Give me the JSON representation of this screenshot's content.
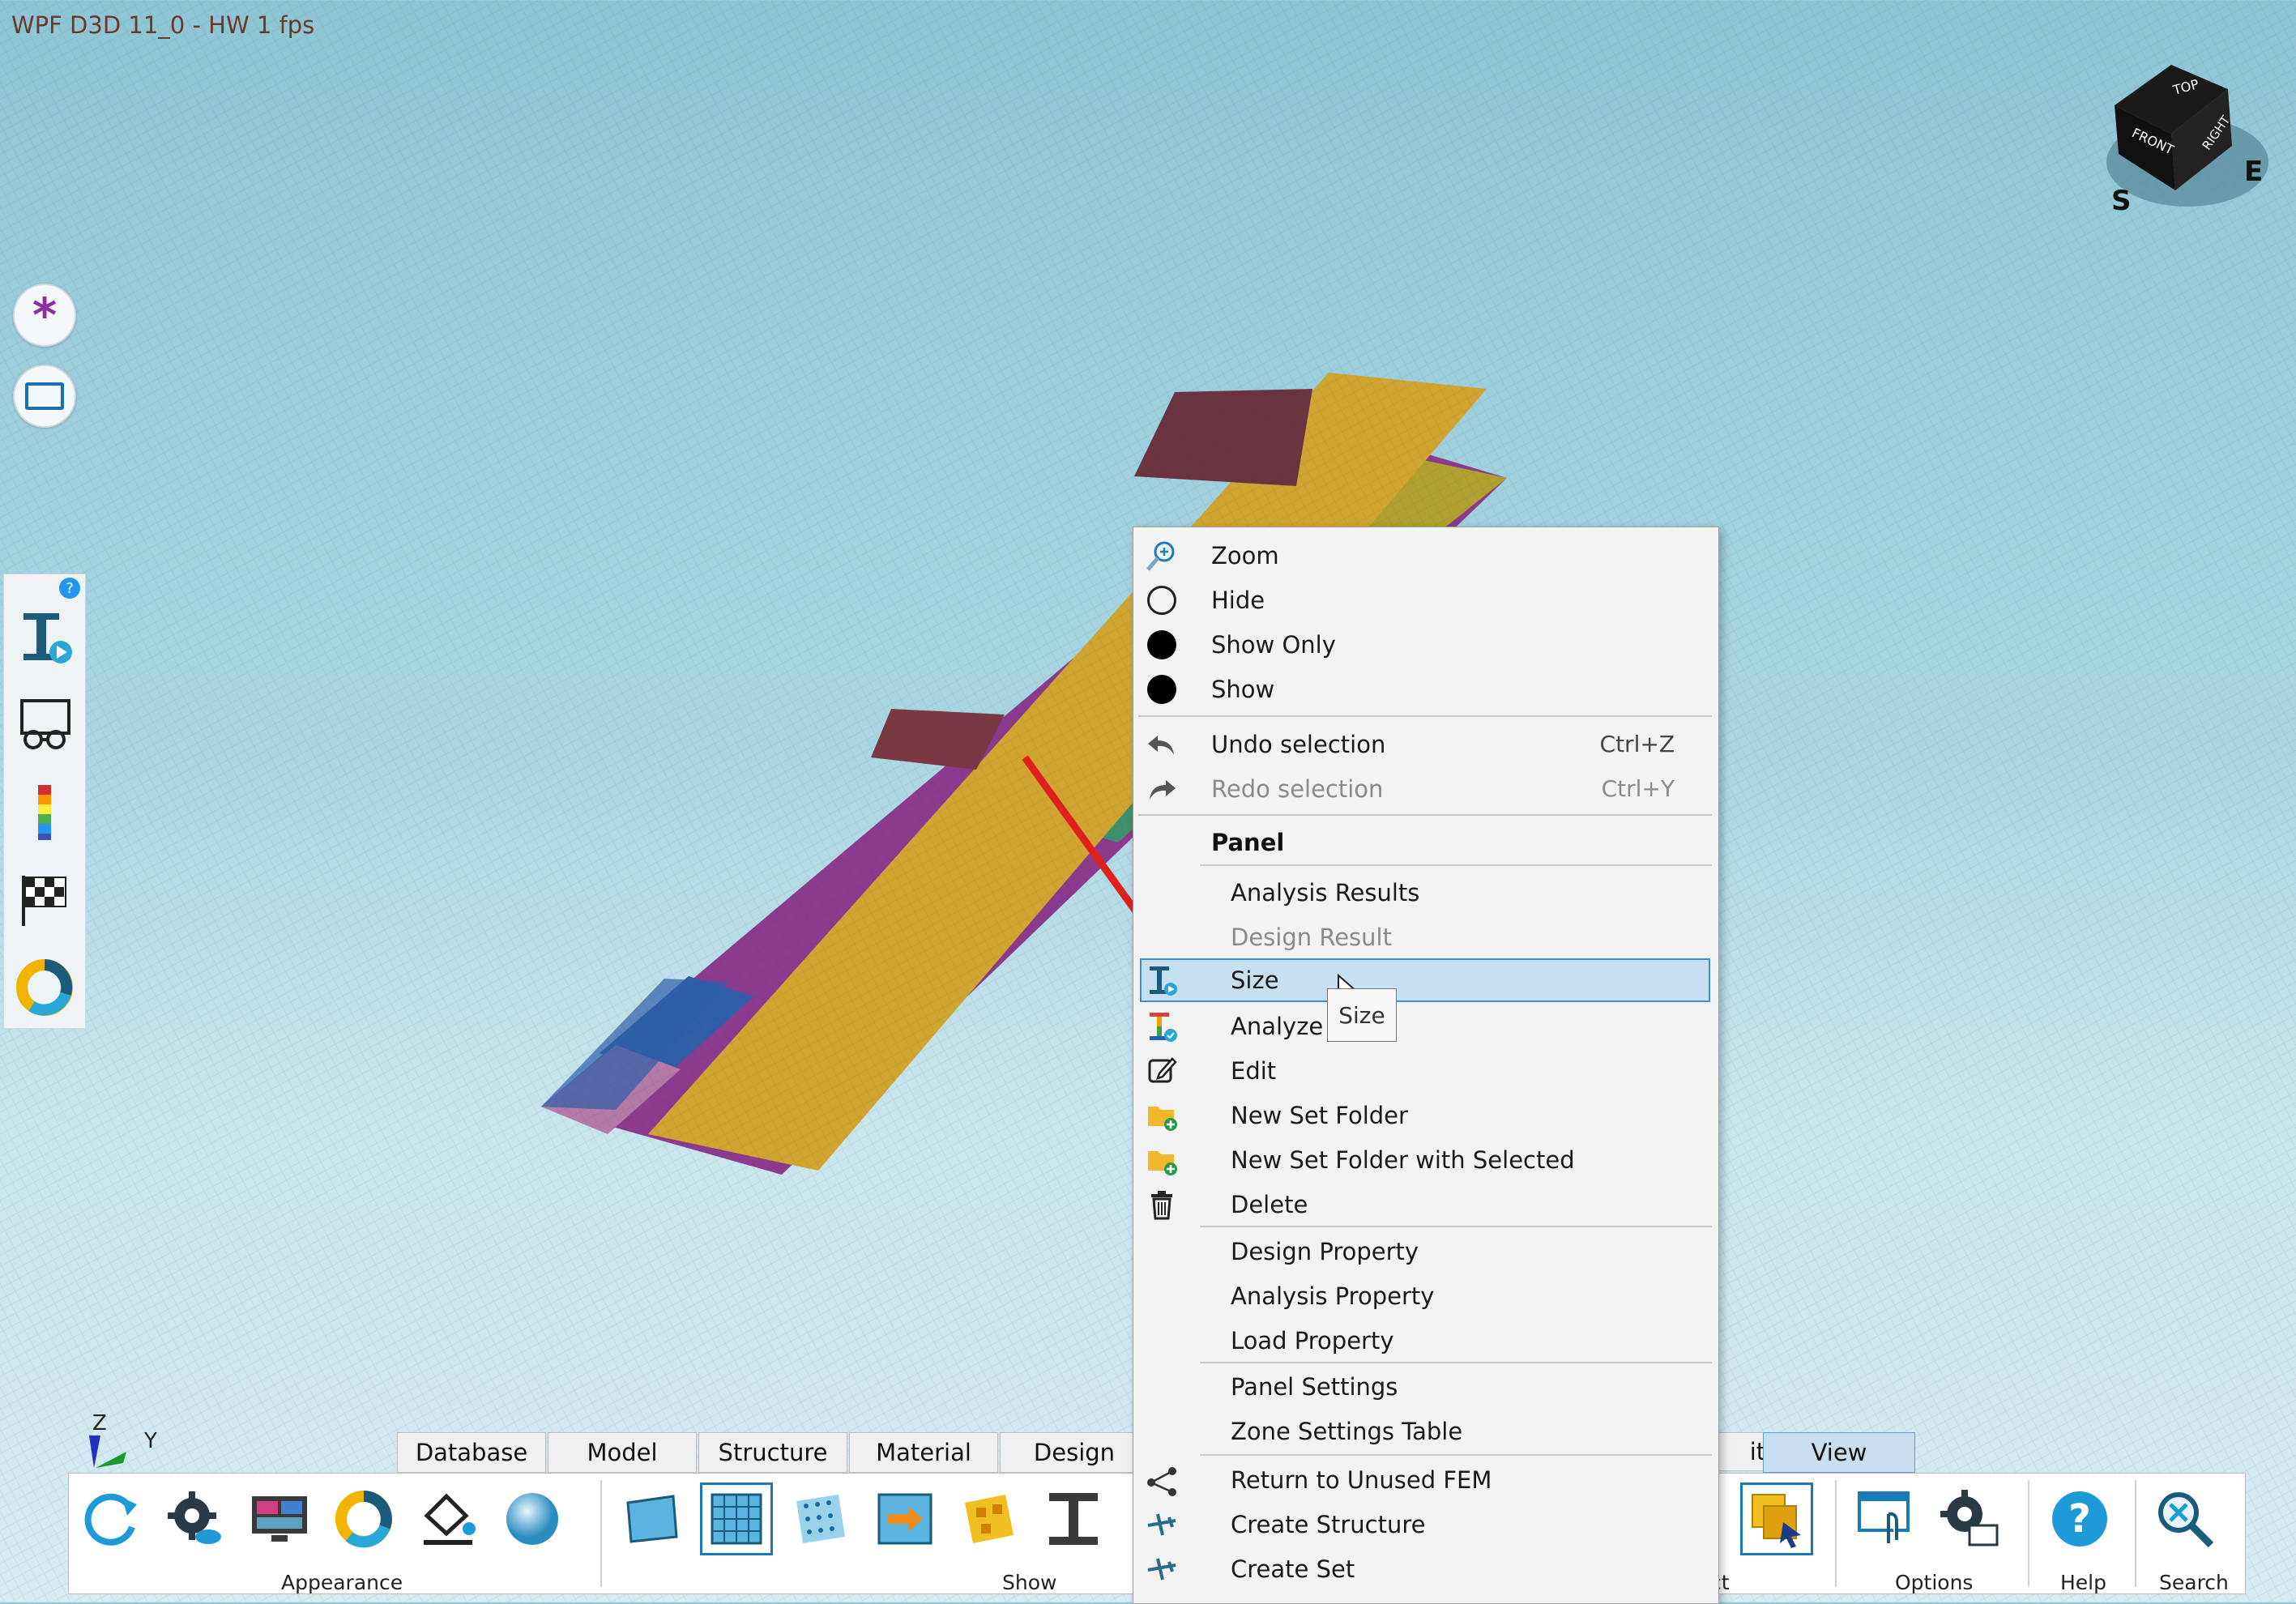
{
  "window": {
    "title": "WPF D3D 11_0 - HW 1 fps"
  },
  "viewcube": {
    "top": "TOP",
    "front": "FRONT",
    "right": "RIGHT",
    "compass_s": "S",
    "compass_e": "E"
  },
  "axes": {
    "z": "Z",
    "y": "Y"
  },
  "left_buttons": [
    {
      "name": "asterisk-icon"
    },
    {
      "name": "rectangle-select-icon"
    }
  ],
  "left_tools": {
    "help": "?"
  },
  "context_menu": {
    "items_top": [
      {
        "label": "Zoom",
        "icon": "zoom-icon"
      },
      {
        "label": "Hide",
        "icon": "circle-outline-icon"
      },
      {
        "label": "Show Only",
        "icon": "circle-filled-icon"
      },
      {
        "label": "Show",
        "icon": "circle-filled-icon"
      }
    ],
    "undo": {
      "label": "Undo selection",
      "shortcut": "Ctrl+Z"
    },
    "redo": {
      "label": "Redo selection",
      "shortcut": "Ctrl+Y"
    },
    "header": "Panel",
    "panel_items": [
      "Analysis Results",
      "Design Result",
      "Size",
      "Analyze",
      "Edit",
      "New Set Folder",
      "New Set Folder with Selected",
      "Delete"
    ],
    "property_items": [
      "Design Property",
      "Analysis Property",
      "Load Property"
    ],
    "settings_items": [
      "Panel Settings",
      "Zone Settings Table"
    ],
    "bottom_items": [
      "Return to Unused FEM",
      "Create Structure",
      "Create Set"
    ]
  },
  "tooltip": "Size",
  "ribbon": {
    "tabs": [
      "Database",
      "Model",
      "Structure",
      "Material",
      "Design",
      "ite",
      "View"
    ],
    "groups": {
      "appearance": "Appearance",
      "show": "Show",
      "ct": "ct",
      "options": "Options",
      "help": "Help",
      "search": "Search"
    }
  }
}
